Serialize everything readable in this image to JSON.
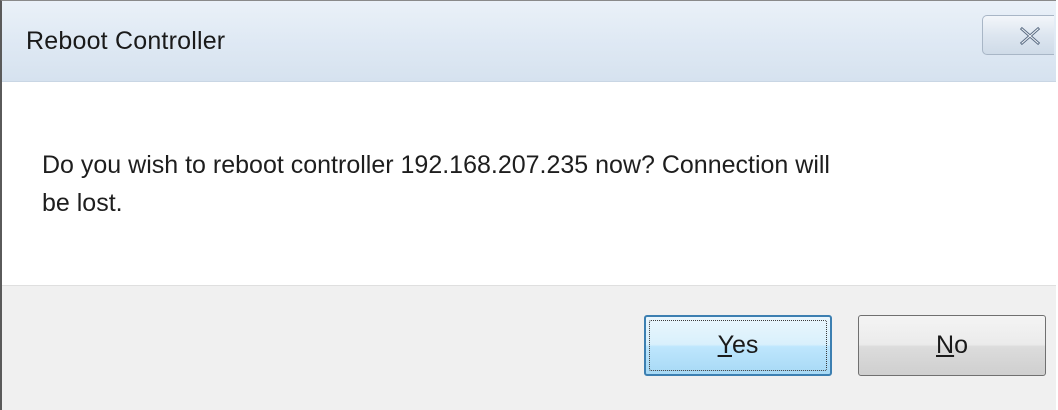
{
  "window": {
    "title": "Reboot Controller",
    "close_icon": "close-icon"
  },
  "dialog": {
    "message_line1": "Do you wish to reboot controller 192.168.207.235 now?  Connection will",
    "message_line2": "be lost."
  },
  "buttons": {
    "yes_mnemonic": "Y",
    "yes_rest": "es",
    "no_mnemonic": "N",
    "no_rest": "o"
  }
}
